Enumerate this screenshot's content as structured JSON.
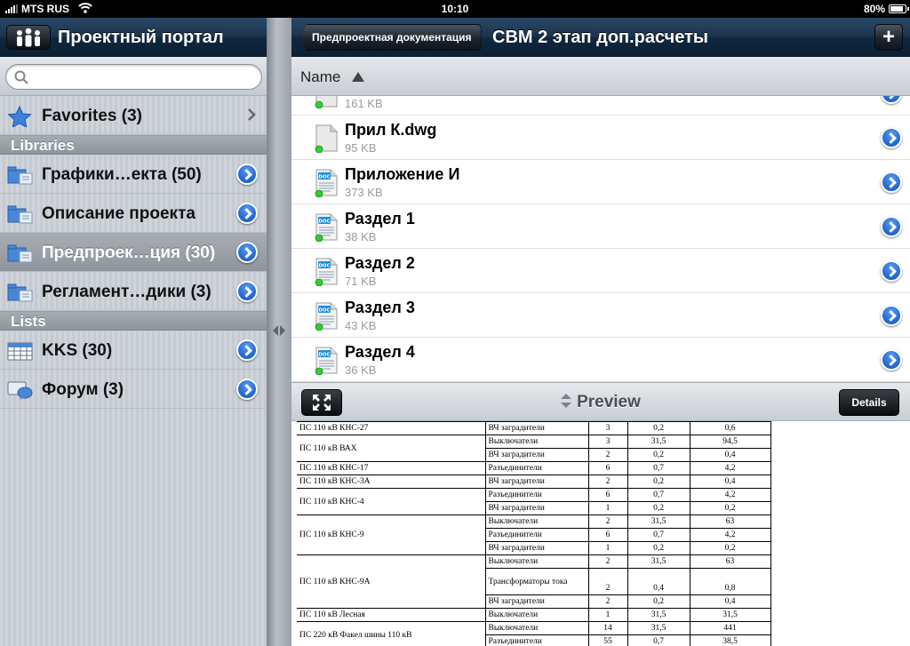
{
  "status_bar": {
    "carrier": "MTS RUS",
    "time": "10:10",
    "battery": "80%"
  },
  "left": {
    "title": "Проектный портал",
    "search": {
      "value": "",
      "placeholder": ""
    },
    "favorites": {
      "label": "Favorites (3)"
    },
    "libraries_header": "Libraries",
    "libraries": [
      {
        "label": "Графики…екта (50)"
      },
      {
        "label": "Описание проекта"
      },
      {
        "label": "Предпроек…ция (30)",
        "selected": true
      },
      {
        "label": "Регламент…дики (3)"
      }
    ],
    "lists_header": "Lists",
    "lists": [
      {
        "label": "KKS (30)"
      },
      {
        "label": "Форум (3)"
      }
    ]
  },
  "right": {
    "back_label": "Предпроектная документация",
    "title": "СВМ 2 этап доп.расчеты",
    "add_label": "+",
    "sort_label": "Name",
    "files": [
      {
        "name": "",
        "size": "161 KB",
        "icon": "generic-file-icon"
      },
      {
        "name": "Прил К.dwg",
        "size": "95 KB",
        "icon": "generic-file-icon"
      },
      {
        "name": "Приложение И",
        "size": "373 KB",
        "icon": "doc-file-icon"
      },
      {
        "name": "Раздел 1",
        "size": "38 KB",
        "icon": "doc-file-icon"
      },
      {
        "name": "Раздел 2",
        "size": "71 KB",
        "icon": "doc-file-icon"
      },
      {
        "name": "Раздел 3",
        "size": "43 KB",
        "icon": "doc-file-icon"
      },
      {
        "name": "Раздел 4",
        "size": "36 KB",
        "icon": "doc-file-icon"
      }
    ],
    "preview_title": "Preview",
    "details_label": "Details",
    "doc_table": [
      {
        "obj": "ПС 110 кВ КНС-27",
        "rows": [
          [
            "ВЧ заградители",
            "3",
            "0,2",
            "0,6"
          ]
        ]
      },
      {
        "obj": "ПС 110 кВ ВАХ",
        "rows": [
          [
            "Выключатели",
            "3",
            "31,5",
            "94,5"
          ],
          [
            "ВЧ заградители",
            "2",
            "0,2",
            "0,4"
          ]
        ]
      },
      {
        "obj": "ПС 110 кВ КНС-17",
        "rows": [
          [
            "Разъединители",
            "6",
            "0,7",
            "4,2"
          ]
        ]
      },
      {
        "obj": "ПС 110 кВ КНС-3А",
        "rows": [
          [
            "ВЧ заградители",
            "2",
            "0,2",
            "0,4"
          ]
        ]
      },
      {
        "obj": "ПС 110 кВ КНС-4",
        "rows": [
          [
            "Разъединители",
            "6",
            "0,7",
            "4,2"
          ],
          [
            "ВЧ заградители",
            "1",
            "0,2",
            "0,2"
          ]
        ]
      },
      {
        "obj": "ПС 110 кВ КНС-9",
        "rows": [
          [
            "Выключатели",
            "2",
            "31,5",
            "63"
          ],
          [
            "Разъединители",
            "6",
            "0,7",
            "4,2"
          ],
          [
            "ВЧ заградители",
            "1",
            "0,2",
            "0,2"
          ]
        ]
      },
      {
        "obj": "ПС 110 кВ КНС-9А",
        "rows": [
          [
            "Выключатели",
            "2",
            "31,5",
            "63"
          ],
          [
            "Трансформаторы тока",
            "2",
            "0,4",
            "0,8"
          ],
          [
            "ВЧ заградители",
            "2",
            "0,2",
            "0,4"
          ]
        ]
      },
      {
        "obj": "ПС 110 кВ Лесная",
        "rows": [
          [
            "Выключатели",
            "1",
            "31,5",
            "31,5"
          ]
        ]
      },
      {
        "obj": "ПС 220 кВ Факел шины 110 кВ",
        "rows": [
          [
            "Выключатели",
            "14",
            "31,5",
            "441"
          ],
          [
            "Разъединители",
            "55",
            "0,7",
            "38,5"
          ]
        ]
      }
    ]
  },
  "colors": {
    "navbar": "#1a334d",
    "sidebar_bg": "#ccd1d8",
    "section_header": "#9aa1a9",
    "selected_row": "#9ba0a6",
    "disclosure_blue": "#2a6fd6",
    "status_green": "#33cc33"
  }
}
